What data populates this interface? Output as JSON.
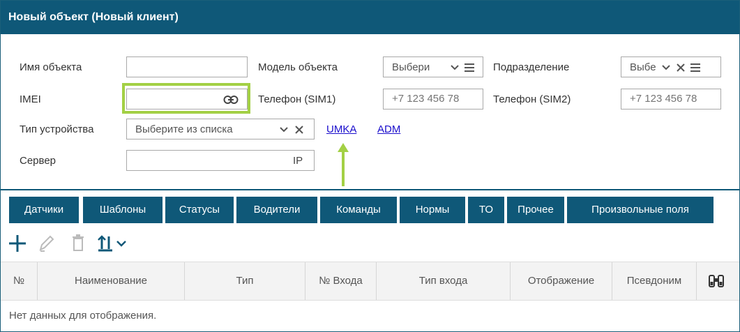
{
  "window": {
    "title": "Новый объект (Новый клиент)"
  },
  "form": {
    "object_name_label": "Имя объекта",
    "object_name_value": "",
    "model_label": "Модель объекта",
    "model_placeholder": "Выбери",
    "division_label": "Подразделение",
    "division_placeholder": "Выбе",
    "imei_label": "IMEI",
    "imei_value": "",
    "phone1_label": "Телефон (SIM1)",
    "phone1_placeholder": "+7 123 456 78",
    "phone2_label": "Телефон (SIM2)",
    "phone2_placeholder": "+7 123 456 78",
    "device_type_label": "Тип устройства",
    "device_type_placeholder": "Выберите из списка",
    "links": [
      "UMKA",
      "ADM"
    ],
    "server_label": "Сервер",
    "server_value": "",
    "server_suffix": "IP"
  },
  "tabs": [
    "Датчики",
    "Шаблоны",
    "Статусы",
    "Водители",
    "Команды",
    "Нормы",
    "ТО",
    "Прочее",
    "Произвольные поля"
  ],
  "table": {
    "columns": [
      "№",
      "Наименование",
      "Тип",
      "№ Входа",
      "Тип входа",
      "Отображение",
      "Псевдоним"
    ],
    "empty_text": "Нет данных для отображения."
  },
  "colors": {
    "header_bg": "#0f5878",
    "highlight": "#a3d045",
    "link": "#1a0dcc"
  },
  "icons": [
    "link-icon",
    "chevron-down-icon",
    "menu-icon",
    "close-icon",
    "add-icon",
    "edit-icon",
    "delete-icon",
    "sort-icon",
    "binoculars-icon",
    "arrow-up-icon"
  ]
}
